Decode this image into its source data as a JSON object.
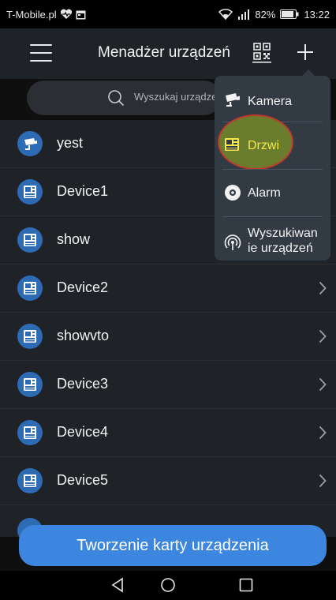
{
  "status_bar": {
    "carrier": "T-Mobile.pl",
    "battery": "82%",
    "time": "13:22"
  },
  "header": {
    "title": "Menadżer urządzeń",
    "menu_icon": "hamburger-menu-icon",
    "qr_icon": "qr-code-scan-icon",
    "add_icon": "plus-icon"
  },
  "search": {
    "placeholder": "Wyszukaj urządzenie"
  },
  "devices": [
    {
      "label": "yest",
      "icon": "camera-icon"
    },
    {
      "label": "Device1",
      "icon": "door-intercom-icon"
    },
    {
      "label": "show",
      "icon": "door-intercom-icon"
    },
    {
      "label": "Device2",
      "icon": "door-intercom-icon"
    },
    {
      "label": "showvto",
      "icon": "door-intercom-icon"
    },
    {
      "label": "Device3",
      "icon": "door-intercom-icon"
    },
    {
      "label": "Device4",
      "icon": "door-intercom-icon"
    },
    {
      "label": "Device5",
      "icon": "door-intercom-icon"
    }
  ],
  "popup_menu": {
    "items": [
      {
        "label": "Kamera",
        "icon": "camera-icon"
      },
      {
        "label": "Drzwi",
        "icon": "door-intercom-icon"
      },
      {
        "label": "Alarm",
        "icon": "alarm-icon"
      },
      {
        "label": "Wyszukiwanie urządzeń",
        "line1": "Wyszukiwan",
        "line2": "ie urządzeń",
        "icon": "wireless-search-icon"
      }
    ],
    "highlighted": "Drzwi"
  },
  "create_button_label": "Tworzenie karty urządzenia",
  "colors": {
    "accent": "#3d86e0",
    "device_icon_bg": "#2d6bb5",
    "highlight_fill": "#6a7c2e",
    "highlight_ring": "#c0392b",
    "drzwi_label": "#f5e94a"
  }
}
